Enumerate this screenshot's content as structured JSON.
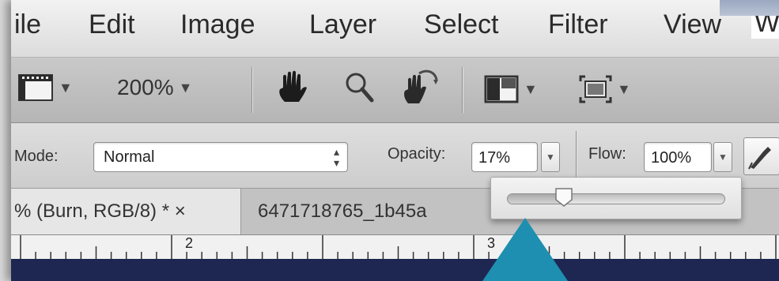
{
  "menu": {
    "items": [
      "ile",
      "Edit",
      "Image",
      "Layer",
      "Select",
      "Filter",
      "View",
      "W"
    ]
  },
  "toolbar": {
    "zoom_value": "200%",
    "tools": [
      "document-icon",
      "hand-icon",
      "zoom-icon",
      "rotate-view-icon",
      "arrange-documents-icon",
      "screen-mode-icon"
    ]
  },
  "options": {
    "mode_label": "Mode:",
    "mode_value": "Normal",
    "opacity_label": "Opacity:",
    "opacity_value": "17%",
    "flow_label": "Flow:",
    "flow_value": "100%",
    "opacity_slider_fraction": 0.17
  },
  "tabs": {
    "active": "% (Burn, RGB/8) * ×",
    "inactive": "6471718765_1b45a"
  },
  "ruler": {
    "labels": [
      "2",
      "3"
    ]
  },
  "colors": {
    "canvas": "#1d2752",
    "callout_arrow": "#1e8fb0"
  }
}
